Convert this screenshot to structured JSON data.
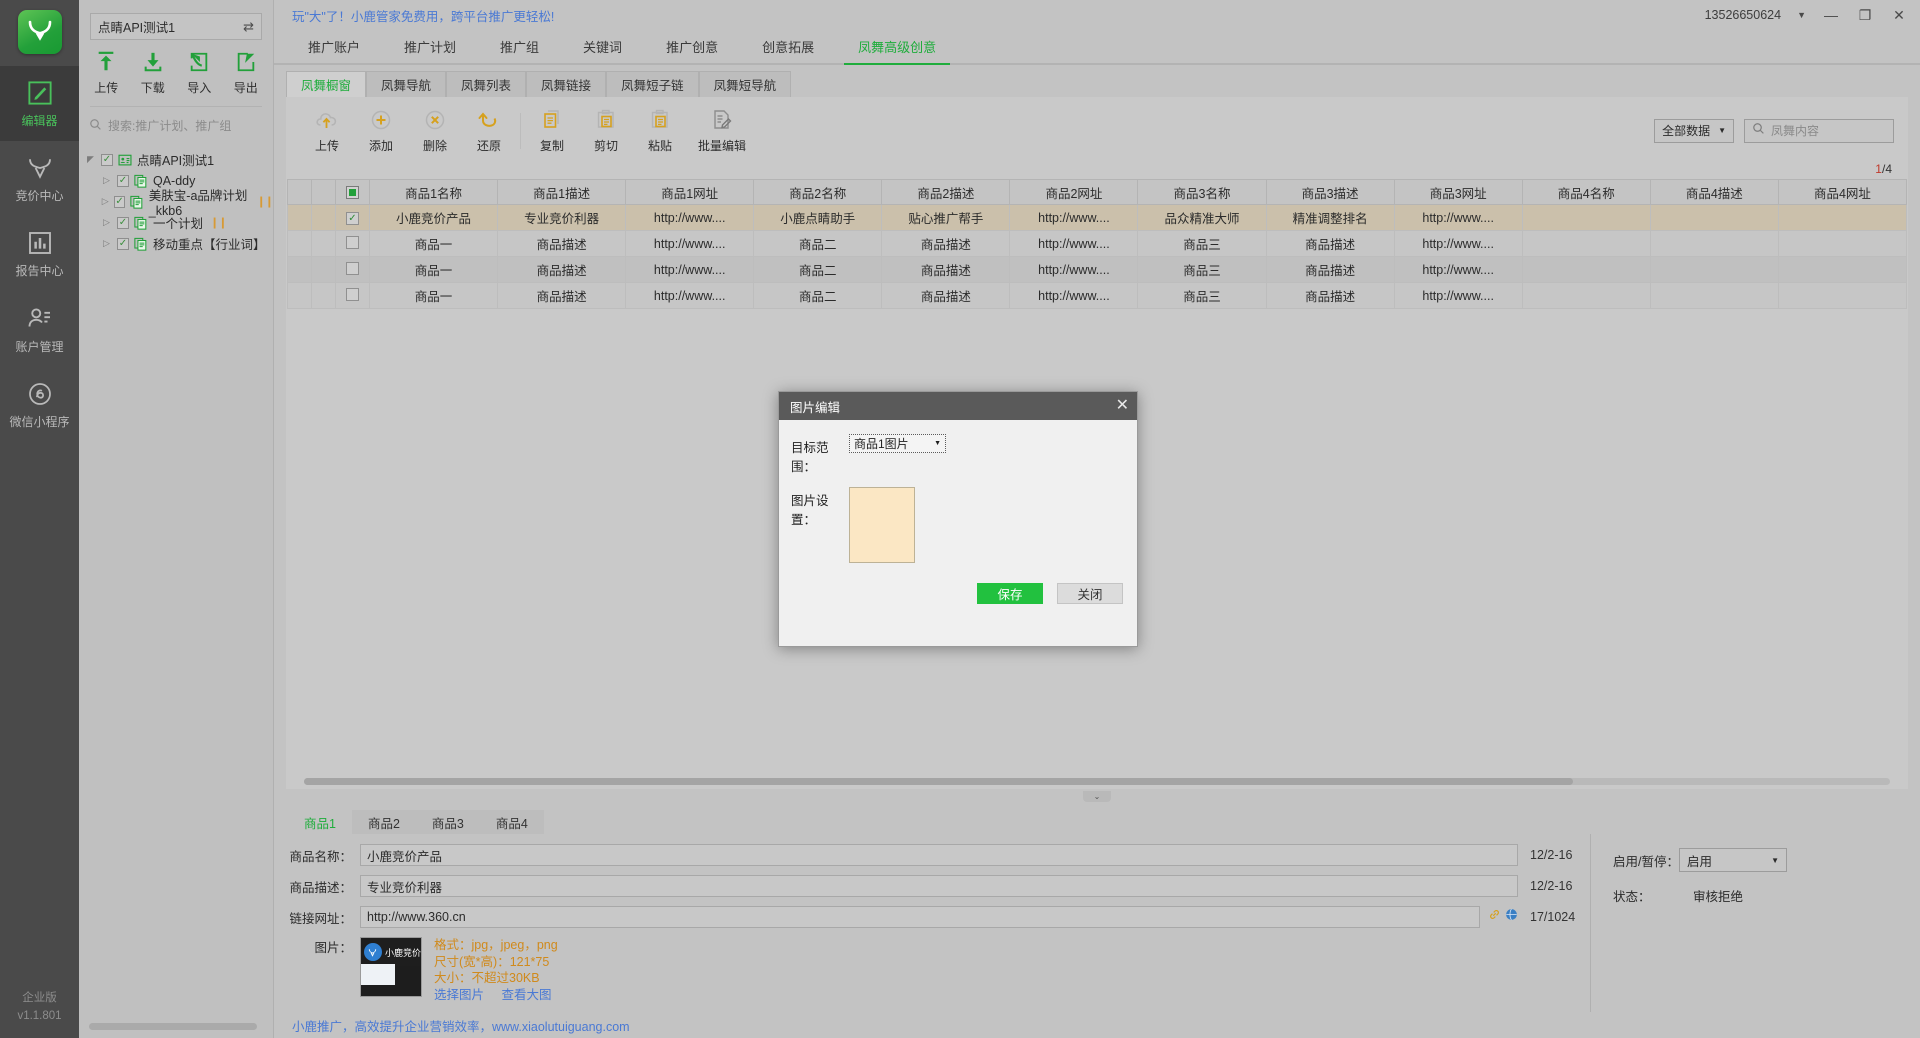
{
  "rail": {
    "logo_icon": "deer-antler-logo",
    "items": [
      {
        "label": "编辑器",
        "icon": "pencil-square-icon",
        "active": true
      },
      {
        "label": "竞价中心",
        "icon": "antler-icon",
        "active": false
      },
      {
        "label": "报告中心",
        "icon": "bar-chart-icon",
        "active": false
      },
      {
        "label": "账户管理",
        "icon": "user-settings-icon",
        "active": false
      },
      {
        "label": "微信小程序",
        "icon": "wechat-miniapp-icon",
        "active": false
      }
    ],
    "edition": "企业版",
    "version": "v1.1.801"
  },
  "left_panel": {
    "account_name": "点睛API测试1",
    "swap_icon": "swap-arrows-icon",
    "tools": [
      {
        "label": "上传",
        "icon": "upload-icon"
      },
      {
        "label": "下载",
        "icon": "download-icon"
      },
      {
        "label": "导入",
        "icon": "import-icon"
      },
      {
        "label": "导出",
        "icon": "export-icon"
      }
    ],
    "search_placeholder": "搜索:推广计划、推广组",
    "search_value": "",
    "tree": [
      {
        "label": "点睛API测试1",
        "level": 1,
        "checked": true,
        "expanded": true,
        "icon": "account-card-icon",
        "paused": false
      },
      {
        "label": "QA-ddy",
        "level": 2,
        "checked": true,
        "expanded": false,
        "icon": "plan-doc-icon",
        "paused": false
      },
      {
        "label": "美肤宝-a品牌计划_kkb6",
        "level": 2,
        "checked": true,
        "expanded": false,
        "icon": "plan-doc-icon",
        "paused": true
      },
      {
        "label": "一个计划",
        "level": 2,
        "checked": true,
        "expanded": false,
        "icon": "plan-doc-icon",
        "paused": true
      },
      {
        "label": "移动重点【行业词】",
        "level": 2,
        "checked": true,
        "expanded": false,
        "icon": "plan-doc-icon",
        "paused": false
      }
    ]
  },
  "titlebar": {
    "promo": "玩\"大\"了！小鹿管家免费用，跨平台推广更轻松!",
    "phone": "13526650624",
    "caret_icon": "chevron-down-icon",
    "minimize_icon": "minimize-icon",
    "restore_icon": "restore-icon",
    "close_icon": "close-icon"
  },
  "main_tabs": [
    {
      "label": "推广账户",
      "active": false
    },
    {
      "label": "推广计划",
      "active": false
    },
    {
      "label": "推广组",
      "active": false
    },
    {
      "label": "关键词",
      "active": false
    },
    {
      "label": "推广创意",
      "active": false
    },
    {
      "label": "创意拓展",
      "active": false
    },
    {
      "label": "凤舞高级创意",
      "active": true
    }
  ],
  "sub_tabs": [
    {
      "label": "凤舞橱窗",
      "active": true
    },
    {
      "label": "凤舞导航",
      "active": false
    },
    {
      "label": "凤舞列表",
      "active": false
    },
    {
      "label": "凤舞链接",
      "active": false
    },
    {
      "label": "凤舞短子链",
      "active": false
    },
    {
      "label": "凤舞短导航",
      "active": false
    }
  ],
  "content_toolbar": [
    {
      "label": "上传",
      "icon": "cloud-upload-icon"
    },
    {
      "label": "添加",
      "icon": "plus-circle-icon"
    },
    {
      "label": "删除",
      "icon": "x-circle-icon"
    },
    {
      "label": "还原",
      "icon": "undo-arrow-icon"
    },
    {
      "label": "复制",
      "icon": "copy-icon"
    },
    {
      "label": "剪切",
      "icon": "cut-clipboard-icon"
    },
    {
      "label": "粘贴",
      "icon": "paste-clipboard-icon"
    },
    {
      "label": "批量编辑",
      "icon": "bulk-edit-icon"
    }
  ],
  "filter": {
    "select_label": "全部数据",
    "select_arrow_icon": "caret-down-icon",
    "search_icon": "search-icon",
    "search_placeholder": "凤舞内容",
    "search_value": ""
  },
  "pager": {
    "current": "1",
    "separator": "/",
    "total": "4"
  },
  "table": {
    "header_select_icon": "select-all-square-icon",
    "columns": [
      "商品1名称",
      "商品1描述",
      "商品1网址",
      "商品2名称",
      "商品2描述",
      "商品2网址",
      "商品3名称",
      "商品3描述",
      "商品3网址",
      "商品4名称",
      "商品4描述",
      "商品4网址"
    ],
    "rows": [
      {
        "selected": true,
        "cells": [
          "小鹿竞价产品",
          "专业竞价利器",
          "http://www....",
          "小鹿点睛助手",
          "贴心推广帮手",
          "http://www....",
          "品众精准大师",
          "精准调整排名",
          "http://www....",
          "",
          "",
          ""
        ]
      },
      {
        "selected": false,
        "cells": [
          "商品一",
          "商品描述",
          "http://www....",
          "商品二",
          "商品描述",
          "http://www....",
          "商品三",
          "商品描述",
          "http://www....",
          "",
          "",
          ""
        ]
      },
      {
        "selected": false,
        "cells": [
          "商品一",
          "商品描述",
          "http://www....",
          "商品二",
          "商品描述",
          "http://www....",
          "商品三",
          "商品描述",
          "http://www....",
          "",
          "",
          ""
        ]
      },
      {
        "selected": false,
        "cells": [
          "商品一",
          "商品描述",
          "http://www....",
          "商品二",
          "商品描述",
          "http://www....",
          "商品三",
          "商品描述",
          "http://www....",
          "",
          "",
          ""
        ]
      }
    ]
  },
  "collapse_icon": "chevron-down-icon",
  "detail": {
    "tabs": [
      {
        "label": "商品1",
        "active": true
      },
      {
        "label": "商品2",
        "active": false
      },
      {
        "label": "商品3",
        "active": false
      },
      {
        "label": "商品4",
        "active": false
      }
    ],
    "fields": [
      {
        "label": "商品名称：",
        "value": "小鹿竞价产品",
        "meta": "12/2-16"
      },
      {
        "label": "商品描述：",
        "value": "专业竞价利器",
        "meta": "12/2-16"
      },
      {
        "label": "链接网址：",
        "value": "http://www.360.cn",
        "meta": "17/1024"
      }
    ],
    "link_icons": [
      "chain-link-icon",
      "globe-icon"
    ],
    "image": {
      "label": "图片：",
      "thumb_icon": "xiaolu-bid-thumbnail",
      "thumb_brand": "小鹿竞价",
      "specs": [
        "格式：jpg，jpeg，png",
        "尺寸(宽*高)：121*75",
        "大小：不超过30KB"
      ],
      "links": [
        "选择图片",
        "查看大图"
      ]
    },
    "right": {
      "status_toggle_label": "启用/暂停：",
      "status_toggle_value": "启用",
      "status_arrow_icon": "caret-down-icon",
      "status_label": "状态：",
      "status_value": "审核拒绝"
    }
  },
  "footer": {
    "text": "小鹿推广，高效提升企业营销效率，www.xiaolutuiguang.com"
  },
  "modal": {
    "title": "图片编辑",
    "close_icon": "close-icon",
    "scope_label": "目标范围：",
    "scope_value": "商品1图片",
    "scope_arrow_icon": "caret-down-icon",
    "image_label": "图片设置：",
    "save_label": "保存",
    "close_label": "关闭"
  },
  "colors": {
    "brand_green": "#22a03a",
    "accent_orange": "#d08a1c",
    "link_blue": "#4a79d4",
    "selected_row": "#cbc0ab",
    "danger_red": "#c0392b"
  }
}
